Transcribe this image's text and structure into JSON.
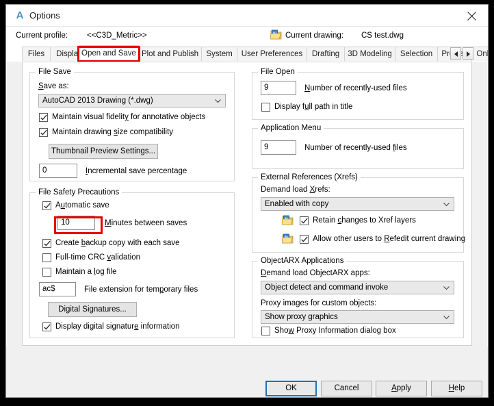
{
  "window": {
    "title": "Options",
    "app_icon": "autocad-a-icon",
    "close_icon": "close-icon"
  },
  "profile_bar": {
    "profile_label": "Current profile:",
    "profile_value": "<<C3D_Metric>>",
    "drawing_icon": "drawing-file-icon",
    "drawing_label": "Current drawing:",
    "drawing_value": "CS test.dwg"
  },
  "tabs": {
    "items": [
      {
        "label": "Files",
        "active": false
      },
      {
        "label": "Display",
        "active": false
      },
      {
        "label": "Open and Save",
        "active": true
      },
      {
        "label": "Plot and Publish",
        "active": false
      },
      {
        "label": "System",
        "active": false
      },
      {
        "label": "User Preferences",
        "active": false
      },
      {
        "label": "Drafting",
        "active": false
      },
      {
        "label": "3D Modeling",
        "active": false
      },
      {
        "label": "Selection",
        "active": false
      },
      {
        "label": "Profiles",
        "active": false
      },
      {
        "label": "Online",
        "active": false
      }
    ],
    "scroll_left_icon": "triangle-left-icon",
    "scroll_right_icon": "triangle-right-icon",
    "highlight_color": "#e60000"
  },
  "file_save": {
    "title": "File Save",
    "save_as_label": "Save as:",
    "save_as_value": "AutoCAD 2013 Drawing (*.dwg)",
    "maintain_fidelity": {
      "label_pre": "Maintain visual fidelit",
      "label_key": "y",
      "label_post": " for annotative objects",
      "checked": true
    },
    "maintain_size": {
      "label_pre": "Maintain drawing",
      "label_key": " ",
      "label_post": "size compatibility",
      "checked": true
    },
    "thumbnail_button": "Thumbnail Preview Settings...",
    "incremental_value": "0",
    "incremental_label": "Incremental save percentage"
  },
  "file_safety": {
    "title": "File Safety Precautions",
    "automatic_save": {
      "label": "Automatic save",
      "checked": true
    },
    "minutes_value": "10",
    "minutes_label": "Minutes between saves",
    "backup_copy": {
      "label": "Create backup copy with each save",
      "checked": true
    },
    "crc_validation": {
      "label": "Full-time CRC validation",
      "checked": false
    },
    "log_file": {
      "label": "Maintain a log file",
      "checked": false
    },
    "temp_ext_value": "ac$",
    "temp_ext_label": "File extension for temporary files",
    "digital_signatures_button": "Digital Signatures...",
    "display_signature": {
      "label": "Display digital signature information",
      "checked": true
    },
    "highlight_color": "#e60000"
  },
  "file_open": {
    "title": "File Open",
    "recent_files_value": "9",
    "recent_files_label": "Number of recently-used files",
    "full_path": {
      "label": "Display full path in title",
      "checked": false
    }
  },
  "application_menu": {
    "title": "Application Menu",
    "recent_files_value": "9",
    "recent_files_label": "Number of recently-used files"
  },
  "external_references": {
    "title": "External References (Xrefs)",
    "demand_load_label": "Demand load Xrefs:",
    "demand_load_value": "Enabled with copy",
    "retain_changes": {
      "label": "Retain changes to Xref layers",
      "checked": true,
      "icon": "xref-drawing-icon"
    },
    "allow_refedit": {
      "label": "Allow other users to Refedit current drawing",
      "checked": true,
      "icon": "xref-drawing-icon"
    }
  },
  "objectarx": {
    "title": "ObjectARX Applications",
    "demand_load_label": "Demand load ObjectARX apps:",
    "demand_load_value": "Object detect and command invoke",
    "proxy_images_label": "Proxy images for custom objects:",
    "proxy_images_value": "Show proxy graphics",
    "show_proxy_dialog": {
      "label": "Show Proxy Information dialog box",
      "checked": false
    }
  },
  "footer": {
    "ok": "OK",
    "cancel": "Cancel",
    "apply": "Apply",
    "help": "Help"
  }
}
